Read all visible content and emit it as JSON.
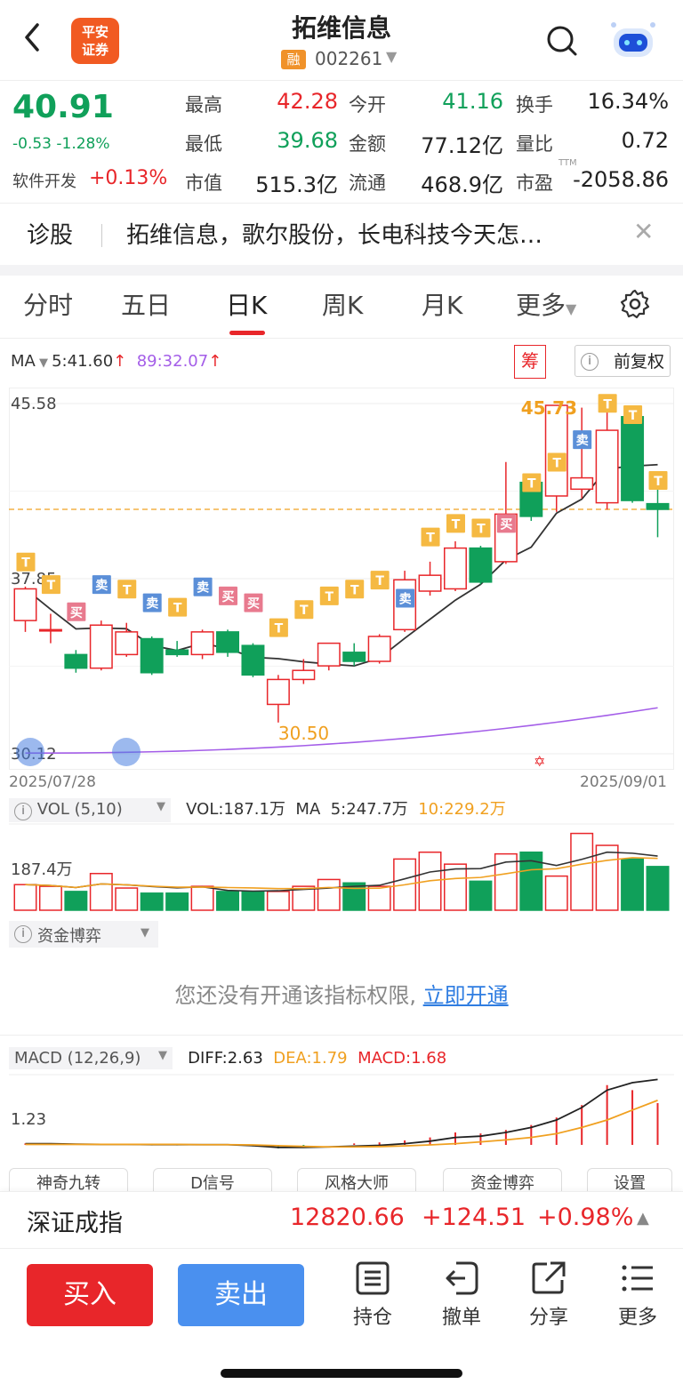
{
  "header": {
    "logo_line1": "平安",
    "logo_line2": "证券",
    "stock_name": "拓维信息",
    "rong_badge": "融",
    "stock_code": "002261"
  },
  "quote": {
    "price": "40.91",
    "change": "-0.53 -1.28%",
    "sector_name": "软件开发",
    "sector_change": "+0.13%",
    "fields": [
      {
        "label": "最高",
        "value": "42.28",
        "color": "#e8262a"
      },
      {
        "label": "今开",
        "value": "41.16",
        "color": "#10a05a"
      },
      {
        "label": "换手",
        "value": "16.34%",
        "color": "#222222"
      },
      {
        "label": "最低",
        "value": "39.68",
        "color": "#10a05a"
      },
      {
        "label": "金额",
        "value": "77.12亿",
        "color": "#222222"
      },
      {
        "label": "量比",
        "value": "0.72",
        "color": "#222222"
      },
      {
        "label": "市值",
        "value": "515.3亿",
        "color": "#222222"
      },
      {
        "label": "流通",
        "value": "468.9亿",
        "color": "#222222"
      },
      {
        "label": "市盈",
        "value": "-2058.86",
        "color": "#222222",
        "sup": "TTM"
      }
    ]
  },
  "diagnosis": {
    "label": "诊股",
    "text": "拓维信息，歌尔股份，长电科技今天怎…"
  },
  "tabs": [
    "分时",
    "五日",
    "日K",
    "周K",
    "月K",
    "更多"
  ],
  "active_tab": "日K",
  "ma": {
    "label": "MA",
    "ma5": "5:41.60",
    "ma89": "89:32.07",
    "chou": "筹",
    "fuquan": "前复权"
  },
  "kline": {
    "y_top": "45.58",
    "y_mid": "37.85",
    "y_bottom": "30.12",
    "high_label": "45.73",
    "low_label": "30.50",
    "date_start": "2025/07/28",
    "date_end": "2025/09/01",
    "signal_t": "T",
    "signal_buy": "买",
    "signal_sell": "卖"
  },
  "volume": {
    "label": "VOL (5,10)",
    "vol": "VOL:187.1万",
    "ma_label": "MA",
    "ma5": "5:247.7万",
    "ma10": "10:229.2万",
    "y_label": "187.4万"
  },
  "fund": {
    "label": "资金博弈",
    "no_permission": "您还没有开通该指标权限,",
    "open_link": "立即开通"
  },
  "macd": {
    "label": "MACD (12,26,9)",
    "diff": "DIFF:2.63",
    "dea": "DEA:1.79",
    "macd": "MACD:1.68",
    "y_label": "1.23"
  },
  "indicator_pills": [
    "神奇九转",
    "D信号",
    "风格大师",
    "资金博弈",
    "设置"
  ],
  "index": {
    "name": "深证成指",
    "value": "12820.66",
    "change": "+124.51",
    "percent": "+0.98%"
  },
  "bottom_bar": {
    "buy": "买入",
    "sell": "卖出",
    "tools": [
      "持仓",
      "撤单",
      "分享",
      "更多"
    ]
  },
  "chart_data": {
    "type": "candlestick",
    "x": [
      "2025/07/28",
      "2025/09/01"
    ],
    "ylim": [
      30.12,
      45.58
    ],
    "candles": [
      {
        "o": 36.0,
        "c": 37.4,
        "h": 37.5,
        "l": 35.5
      },
      {
        "o": 35.6,
        "c": 35.6,
        "h": 36.3,
        "l": 35.0
      },
      {
        "o": 34.5,
        "c": 33.9,
        "h": 34.7,
        "l": 33.7
      },
      {
        "o": 33.9,
        "c": 35.8,
        "h": 36.0,
        "l": 33.8
      },
      {
        "o": 34.5,
        "c": 35.5,
        "h": 35.9,
        "l": 34.4
      },
      {
        "o": 35.2,
        "c": 33.7,
        "h": 35.3,
        "l": 33.6
      },
      {
        "o": 34.7,
        "c": 34.5,
        "h": 35.1,
        "l": 34.4
      },
      {
        "o": 34.5,
        "c": 35.5,
        "h": 35.6,
        "l": 34.3
      },
      {
        "o": 35.5,
        "c": 34.6,
        "h": 35.6,
        "l": 34.4
      },
      {
        "o": 34.9,
        "c": 33.6,
        "h": 35.0,
        "l": 33.5
      },
      {
        "o": 32.3,
        "c": 33.4,
        "h": 33.6,
        "l": 31.5
      },
      {
        "o": 33.4,
        "c": 33.8,
        "h": 34.3,
        "l": 33.2
      },
      {
        "o": 34.0,
        "c": 35.0,
        "h": 35.0,
        "l": 33.8
      },
      {
        "o": 34.6,
        "c": 34.2,
        "h": 35.0,
        "l": 34.0
      },
      {
        "o": 34.2,
        "c": 35.3,
        "h": 35.4,
        "l": 34.1
      },
      {
        "o": 35.6,
        "c": 37.8,
        "h": 38.2,
        "l": 35.5
      },
      {
        "o": 37.3,
        "c": 38.0,
        "h": 38.6,
        "l": 37.1
      },
      {
        "o": 37.4,
        "c": 39.2,
        "h": 39.5,
        "l": 37.3
      },
      {
        "o": 39.2,
        "c": 37.7,
        "h": 39.3,
        "l": 37.6
      },
      {
        "o": 38.6,
        "c": 40.7,
        "h": 43.0,
        "l": 38.5
      },
      {
        "o": 42.1,
        "c": 40.6,
        "h": 42.5,
        "l": 40.4
      },
      {
        "o": 41.5,
        "c": 45.5,
        "h": 45.5,
        "l": 40.8
      },
      {
        "o": 41.8,
        "c": 42.3,
        "h": 45.4,
        "l": 41.4
      },
      {
        "o": 41.2,
        "c": 44.4,
        "h": 45.6,
        "l": 40.9
      },
      {
        "o": 45.0,
        "c": 41.3,
        "h": 45.1,
        "l": 41.2
      },
      {
        "o": 41.16,
        "c": 40.91,
        "h": 42.28,
        "l": 39.68
      }
    ],
    "volume": [
      150,
      140,
      110,
      215,
      130,
      100,
      100,
      140,
      110,
      110,
      110,
      140,
      180,
      160,
      140,
      300,
      340,
      270,
      170,
      330,
      340,
      200,
      450,
      380,
      300,
      256
    ],
    "macd_diff": [
      0.05,
      0.05,
      0.03,
      0.02,
      0.02,
      0.01,
      0.01,
      0.01,
      0.01,
      -0.03,
      -0.1,
      -0.1,
      -0.08,
      -0.05,
      -0.02,
      0.05,
      0.15,
      0.3,
      0.35,
      0.5,
      0.7,
      1.0,
      1.5,
      2.2,
      2.5,
      2.63
    ],
    "macd_dea": [
      0.02,
      0.02,
      0.02,
      0.02,
      0.02,
      0.02,
      0.02,
      0.01,
      0.01,
      0.0,
      -0.03,
      -0.06,
      -0.08,
      -0.08,
      -0.07,
      -0.04,
      0.0,
      0.05,
      0.12,
      0.2,
      0.3,
      0.45,
      0.7,
      1.0,
      1.4,
      1.79
    ]
  }
}
